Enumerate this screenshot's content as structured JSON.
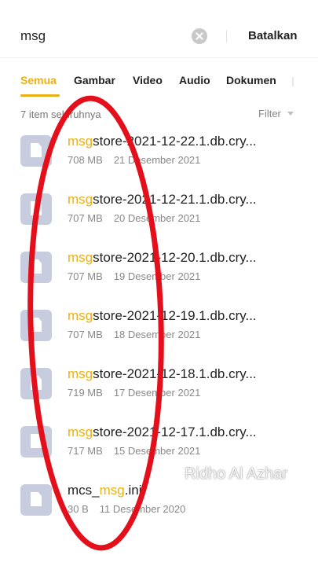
{
  "search": {
    "query": "msg",
    "cancel_label": "Batalkan"
  },
  "tabs": [
    {
      "label": "Semua",
      "active": true
    },
    {
      "label": "Gambar",
      "active": false
    },
    {
      "label": "Video",
      "active": false
    },
    {
      "label": "Audio",
      "active": false
    },
    {
      "label": "Dokumen",
      "active": false
    }
  ],
  "results": {
    "count_label": "7 item seluruhnya",
    "filter_label": "Filter"
  },
  "files": [
    {
      "match": "msg",
      "name_pre": "",
      "name_rest": "store-2021-12-22.1.db.cry...",
      "size": "708 MB",
      "date": "21 Desember 2021"
    },
    {
      "match": "msg",
      "name_pre": "",
      "name_rest": "store-2021-12-21.1.db.cry...",
      "size": "707 MB",
      "date": "20 Desember 2021"
    },
    {
      "match": "msg",
      "name_pre": "",
      "name_rest": "store-2021-12-20.1.db.cry...",
      "size": "707 MB",
      "date": "19 Desember 2021"
    },
    {
      "match": "msg",
      "name_pre": "",
      "name_rest": "store-2021-12-19.1.db.cry...",
      "size": "707 MB",
      "date": "18 Desember 2021"
    },
    {
      "match": "msg",
      "name_pre": "",
      "name_rest": "store-2021-12-18.1.db.cry...",
      "size": "719 MB",
      "date": "17 Desember 2021"
    },
    {
      "match": "msg",
      "name_pre": "",
      "name_rest": "store-2021-12-17.1.db.cry...",
      "size": "717 MB",
      "date": "15 Desember 2021"
    },
    {
      "match": "msg",
      "name_pre": "mcs_",
      "name_rest": ".ini",
      "size": "30 B",
      "date": "11 Desember 2020"
    }
  ],
  "watermark": "Ridho Al Azhar",
  "colors": {
    "accent": "#e9b114",
    "file_icon": "#c7ccdf",
    "annotation_ring": "#e3101b"
  },
  "icons": {
    "clear": "clear-circle-icon",
    "file": "document-file-icon",
    "filter": "caret-down-icon"
  }
}
